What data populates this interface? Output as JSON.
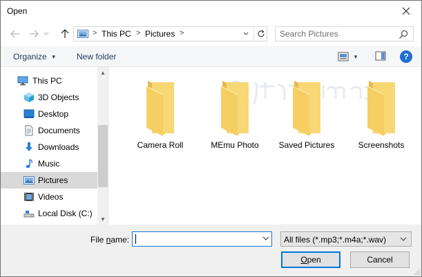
{
  "window": {
    "title": "Open"
  },
  "nav": {
    "back_icon": "arrow-left-icon",
    "forward_icon": "arrow-right-icon",
    "recent_icon": "chevron-down-icon",
    "up_icon": "arrow-up-icon"
  },
  "address": {
    "parts": [
      "This PC",
      "Pictures"
    ],
    "separator": ">"
  },
  "search": {
    "placeholder": "Search Pictures"
  },
  "toolbar": {
    "organize_label": "Organize",
    "new_folder_label": "New folder"
  },
  "sidebar": {
    "items": [
      {
        "label": "This PC",
        "icon": "computer-icon",
        "selected": false
      },
      {
        "label": "3D Objects",
        "icon": "cube-icon",
        "selected": false
      },
      {
        "label": "Desktop",
        "icon": "desktop-icon",
        "selected": false
      },
      {
        "label": "Documents",
        "icon": "document-icon",
        "selected": false
      },
      {
        "label": "Downloads",
        "icon": "download-arrow-icon",
        "selected": false
      },
      {
        "label": "Music",
        "icon": "music-note-icon",
        "selected": false
      },
      {
        "label": "Pictures",
        "icon": "pictures-icon",
        "selected": true
      },
      {
        "label": "Videos",
        "icon": "film-icon",
        "selected": false
      },
      {
        "label": "Local Disk (C:)",
        "icon": "drive-icon",
        "selected": false
      }
    ]
  },
  "files": [
    {
      "name": "Camera Roll",
      "icon": "folder-icon"
    },
    {
      "name": "MEmu Photo",
      "icon": "folder-icon"
    },
    {
      "name": "Saved Pictures",
      "icon": "folder-icon"
    },
    {
      "name": "Screenshots",
      "icon": "folder-icon"
    }
  ],
  "watermark": {
    "logo": "quantrimang-logo"
  },
  "bottom": {
    "file_name_label_pre": "File ",
    "file_name_label_key": "n",
    "file_name_label_post": "ame:",
    "file_name_value": "",
    "filter_value": "All files (*.mp3;*.m4a;*.wav)",
    "open_key": "O",
    "open_rest": "pen",
    "cancel_label": "Cancel"
  },
  "colors": {
    "accent": "#0078d7",
    "folder": "#f8d775",
    "folder_dark": "#e8b84a",
    "selected_bg": "#d9d9d9",
    "help": "#1d6fd1"
  }
}
